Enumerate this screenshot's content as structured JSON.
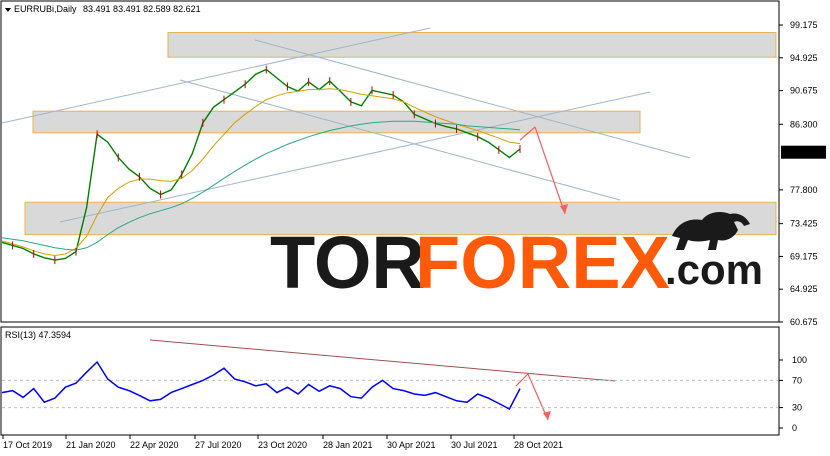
{
  "header": {
    "symbol_text": "EURRUBi,Daily",
    "ohlc_text": "83.491 83.491 82.589 82.621"
  },
  "rsi_header": {
    "label_text": "RSI(13) 47.3594"
  },
  "watermark": {
    "part1": "TOR",
    "part2": "FOREX",
    "part3": ".com",
    "color_dark": "#1a1a1a",
    "color_accent": "#ff5a0a"
  },
  "colors": {
    "price": "#008000",
    "ma_fast": "#d4a000",
    "ma_slow": "#2aa88a",
    "rsi": "#0000ff",
    "channel": "#9fb6c9",
    "zone_fill": "#d9d9d9",
    "zone_border": "#e6b450",
    "forecast_arrow": "#f46060",
    "rsi_trend": "#a05050",
    "last_price_bg": "#000000"
  },
  "chart_data": [
    {
      "type": "line",
      "title": "EURRUBi,Daily",
      "ylim": [
        60.675,
        99.175
      ],
      "y_ticks": [
        99.175,
        94.925,
        90.675,
        86.3,
        82.621,
        77.8,
        73.425,
        69.175,
        64.925,
        60.675
      ],
      "y_tick_labels": [
        "99.175",
        "94.925",
        "90.675",
        "86.300",
        "82.621",
        "77.800",
        "73.425",
        "69.175",
        "64.925",
        "60.675"
      ],
      "x_tick_labels": [
        "17 Oct 2019",
        "21 Jan 2020",
        "22 Apr 2020",
        "27 Jul 2020",
        "23 Oct 2020",
        "28 Jan 2021",
        "30 Apr 2021",
        "30 Jul 2021",
        "28 Oct 2021"
      ],
      "last_price": 82.621,
      "series": [
        {
          "values": [
            71.0,
            70.6,
            70.2,
            69.5,
            69.0,
            68.7,
            68.9,
            69.8,
            75.5,
            85.0,
            84.0,
            82.0,
            80.5,
            79.5,
            78.0,
            77.2,
            77.8,
            79.8,
            82.5,
            86.5,
            88.5,
            89.5,
            90.5,
            91.5,
            92.8,
            93.4,
            92.3,
            91.2,
            90.6,
            91.8,
            90.8,
            91.9,
            90.6,
            89.2,
            88.7,
            90.7,
            90.4,
            90.1,
            89.2,
            87.6,
            87.0,
            86.4,
            86.0,
            85.7,
            85.2,
            84.7,
            84.0,
            83.0,
            82.0,
            83.1
          ]
        },
        {
          "values": [
            71.2,
            70.8,
            70.4,
            69.9,
            69.5,
            69.3,
            69.5,
            70.2,
            71.8,
            74.5,
            76.8,
            78.0,
            78.8,
            79.2,
            79.2,
            79.0,
            78.9,
            79.3,
            80.3,
            81.8,
            83.5,
            85.0,
            86.5,
            87.6,
            88.6,
            89.5,
            90.0,
            90.4,
            90.6,
            90.8,
            90.8,
            90.9,
            90.8,
            90.5,
            90.2,
            90.0,
            89.8,
            89.6,
            89.2,
            88.5,
            87.9,
            87.3,
            86.8,
            86.3,
            85.9,
            85.5,
            85.0,
            84.5,
            84.0,
            83.8
          ]
        },
        {
          "values": [
            71.6,
            71.4,
            71.2,
            70.9,
            70.6,
            70.3,
            70.1,
            70.0,
            70.3,
            71.0,
            72.0,
            72.9,
            73.6,
            74.2,
            74.7,
            75.1,
            75.5,
            76.0,
            76.7,
            77.5,
            78.4,
            79.3,
            80.2,
            81.0,
            81.8,
            82.5,
            83.1,
            83.7,
            84.2,
            84.7,
            85.1,
            85.5,
            85.8,
            86.1,
            86.3,
            86.5,
            86.6,
            86.7,
            86.7,
            86.7,
            86.6,
            86.5,
            86.4,
            86.3,
            86.1,
            86.0,
            85.9,
            85.8,
            85.7,
            85.6
          ]
        }
      ],
      "zones": [
        {
          "top": 98.2,
          "bottom": 95.0
        },
        {
          "top": 88.0,
          "bottom": 85.2
        },
        {
          "top": 76.2,
          "bottom": 72.0
        }
      ]
    },
    {
      "type": "line",
      "title": "RSI(13) 47.3594",
      "ylim": [
        0,
        100
      ],
      "y_tick_labels": [
        "100",
        "70",
        "30",
        "0"
      ],
      "y_ticks": [
        100,
        70,
        30,
        0
      ],
      "series": [
        {
          "values": [
            52,
            55,
            45,
            58,
            38,
            44,
            60,
            66,
            82,
            97,
            72,
            60,
            55,
            48,
            40,
            42,
            52,
            58,
            64,
            70,
            78,
            88,
            72,
            68,
            62,
            65,
            52,
            60,
            50,
            64,
            54,
            62,
            58,
            46,
            44,
            60,
            70,
            58,
            55,
            50,
            48,
            52,
            46,
            40,
            38,
            50,
            44,
            36,
            28,
            58
          ]
        }
      ]
    }
  ]
}
